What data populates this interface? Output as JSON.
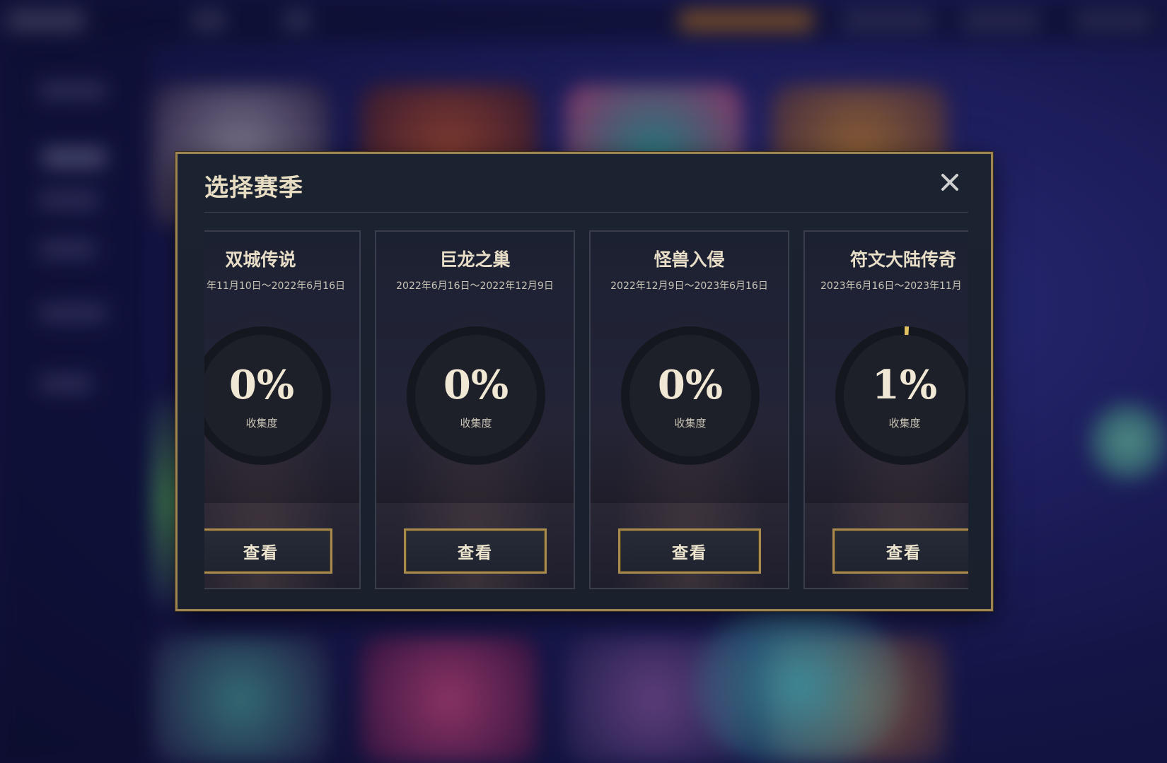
{
  "modal": {
    "title": "选择赛季"
  },
  "seasons": [
    {
      "name": "双城传说",
      "dates": "年11月10日～2022年6月16日",
      "collection_percent": "0%",
      "collection_fraction": 0.0,
      "collection_label": "收集度",
      "button_label": "查看"
    },
    {
      "name": "巨龙之巢",
      "dates": "2022年6月16日～2022年12月9日",
      "collection_percent": "0%",
      "collection_fraction": 0.0,
      "collection_label": "收集度",
      "button_label": "查看"
    },
    {
      "name": "怪兽入侵",
      "dates": "2022年12月9日～2023年6月16日",
      "collection_percent": "0%",
      "collection_fraction": 0.0,
      "collection_label": "收集度",
      "button_label": "查看"
    },
    {
      "name": "符文大陆传奇",
      "dates": "2023年6月16日～2023年11月",
      "collection_percent": "1%",
      "collection_fraction": 0.01,
      "collection_label": "收集度",
      "button_label": "查看"
    }
  ],
  "colors": {
    "accent_gold": "#a8894e",
    "ring_progress": "#e0c060",
    "ring_track": "#15171f"
  },
  "icons": {
    "close": "close-icon"
  }
}
